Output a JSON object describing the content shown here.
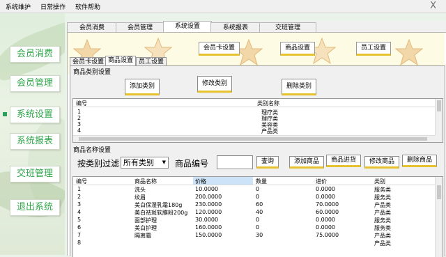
{
  "menubar": {
    "items": [
      "系统维护",
      "日常操作",
      "软件帮助"
    ],
    "close": "X"
  },
  "sidebar": {
    "items": [
      "会员消费",
      "会员管理",
      "系统设置",
      "系统报表",
      "交班管理",
      "退出系统"
    ]
  },
  "tabs": [
    "会员消费",
    "会员管理",
    "系统设置",
    "系统报表",
    "交班管理"
  ],
  "banner": {
    "buttons": [
      "会员卡设置",
      "商品设置",
      "员工设置"
    ]
  },
  "subtabs": [
    "会员卡设置",
    "商品设置",
    "员工设置"
  ],
  "category_section": {
    "title": "商品类别设置",
    "buttons": [
      "添加类别",
      "修改类别",
      "删除类别"
    ],
    "columns": [
      "编号",
      "类别名称"
    ],
    "rows": [
      {
        "id": "1",
        "name": "理疗类"
      },
      {
        "id": "2",
        "name": "理疗类"
      },
      {
        "id": "3",
        "name": "美容类"
      },
      {
        "id": "4",
        "name": "产品类"
      }
    ]
  },
  "product_section": {
    "title": "商品名称设置",
    "filter_label": "按类别过滤",
    "filter_value": "所有类别",
    "code_label": "商品编号",
    "code_value": "",
    "buttons": [
      "查询",
      "添加商品",
      "商品进货",
      "修改商品",
      "删除商品"
    ],
    "columns": [
      "编号",
      "商品名称",
      "价格",
      "数量",
      "进价",
      "类别"
    ],
    "rows": [
      [
        "1",
        "洗头",
        "10.0000",
        "0",
        "0.0000",
        "服务类"
      ],
      [
        "2",
        "纹眉",
        "200.0000",
        "0",
        "0.0000",
        "服务类"
      ],
      [
        "3",
        "美白保湿乳霜180g",
        "230.0000",
        "60",
        "70.0000",
        "产品类"
      ],
      [
        "4",
        "美白祛斑软膜粉200g",
        "120.0000",
        "40",
        "60.0000",
        "产品类"
      ],
      [
        "5",
        "面部护理",
        "30.0000",
        "0",
        "0.0000",
        "服务类"
      ],
      [
        "6",
        "美白护理",
        "160.0000",
        "0",
        "0.0000",
        "服务类"
      ],
      [
        "7",
        "隔离霜",
        "150.0000",
        "30",
        "75.0000",
        "产品类"
      ],
      [
        "8",
        "",
        "",
        "",
        "",
        "产品类"
      ]
    ]
  },
  "colors": {
    "sidebar_text": "#2fa64a",
    "accent_underline": "#e6c22e",
    "banner_bg": "#fdfbe4"
  }
}
